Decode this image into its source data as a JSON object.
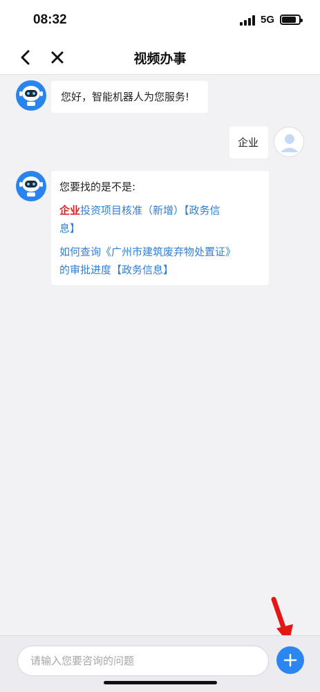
{
  "status": {
    "time": "08:32",
    "network": "5G"
  },
  "nav": {
    "title": "视频办事"
  },
  "messages": {
    "greeting": "您好，智能机器人为您服务!",
    "user_query": "企业",
    "suggest_intro": "您要找的是不是:",
    "suggestion1_highlight": "企业",
    "suggestion1_rest": "投资项目核准（新增）【政务信",
    "suggestion1_rest2": "息】",
    "suggestion2_line1": "如何查询《广州市建筑废弃物处置证》",
    "suggestion2_line2": "的审批进度【政务信息】"
  },
  "input": {
    "placeholder": "请输入您要咨询的问题"
  },
  "colors": {
    "accent": "#2b86f0",
    "link": "#2f7fd6",
    "highlight": "#e02020",
    "annotation_arrow": "#e51616"
  },
  "icons": [
    "back-icon",
    "close-icon",
    "robot-avatar-icon",
    "user-avatar-icon",
    "plus-icon",
    "red-arrow-annotation"
  ]
}
